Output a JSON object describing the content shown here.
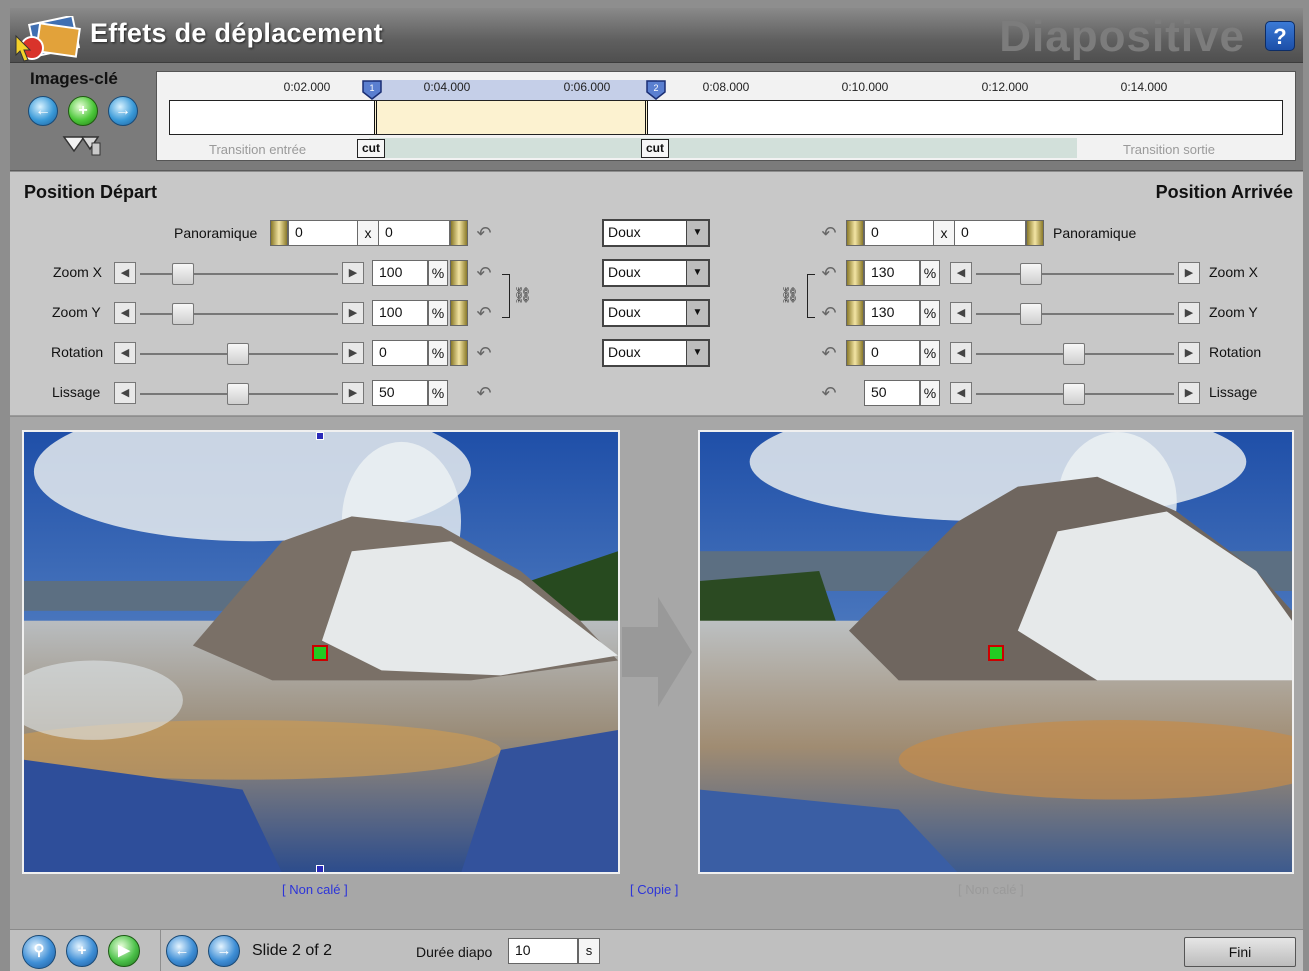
{
  "header": {
    "title": "Effets de déplacement",
    "brand": "Diapositive",
    "help_label": "?"
  },
  "keyframes": {
    "label": "Images-clé",
    "prev_icon": "arrow-left-icon",
    "add_icon": "add-keyframe-icon",
    "next_icon": "arrow-right-icon",
    "copy_icon": "keyframe-copy-icon"
  },
  "timeline": {
    "ticks": [
      "0:02.000",
      "0:04.000",
      "0:06.000",
      "0:08.000",
      "0:10.000",
      "0:12.000",
      "0:14.000"
    ],
    "markers": [
      "1",
      "2"
    ],
    "cut_labels": [
      "cut",
      "cut"
    ],
    "transition_in": "Transition entrée",
    "transition_out": "Transition sortie"
  },
  "start": {
    "title": "Position Départ",
    "pan_label": "Panoramique",
    "pan_x": "0",
    "pan_sep": "x",
    "pan_y": "0",
    "zoom_x_label": "Zoom X",
    "zoom_x": "100",
    "zoom_y_label": "Zoom Y",
    "zoom_y": "100",
    "rotation_label": "Rotation",
    "rotation": "0",
    "smooth_label": "Lissage",
    "smooth": "50",
    "pct": "%"
  },
  "easing": [
    "Doux",
    "Doux",
    "Doux",
    "Doux"
  ],
  "end": {
    "title": "Position Arrivée",
    "pan_label": "Panoramique",
    "pan_x": "0",
    "pan_sep": "x",
    "pan_y": "0",
    "zoom_x_label": "Zoom X",
    "zoom_x": "130",
    "zoom_y_label": "Zoom Y",
    "zoom_y": "130",
    "rotation_label": "Rotation",
    "rotation": "0",
    "smooth_label": "Lissage",
    "smooth": "50",
    "pct": "%"
  },
  "preview": {
    "left_status": "[ Non calé ]",
    "copy_link": "[ Copie ]",
    "right_status": "[ Non calé ]"
  },
  "footer": {
    "slide_counter": "Slide 2 of 2",
    "duration_label": "Durée diapo",
    "duration_value": "10",
    "duration_unit": "s",
    "done_label": "Fini"
  },
  "colors": {
    "accent_blue": "#2c34d9",
    "selection": "#fcf2d0",
    "marker_red": "#cc0000",
    "marker_green": "#22cc22"
  }
}
